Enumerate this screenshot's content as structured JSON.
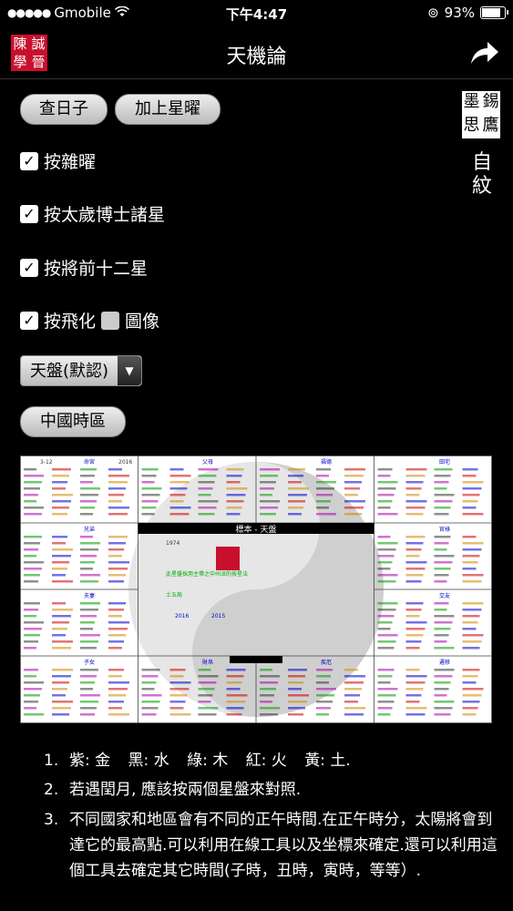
{
  "status_bar": {
    "carrier": "Gmobile",
    "time": "下午4:47",
    "battery": "93%",
    "battery_level": 0.93
  },
  "nav": {
    "title": "天機論",
    "logo_chars": [
      "陳",
      "誠",
      "學",
      "晉"
    ],
    "share_icon": "share-arrow-icon"
  },
  "buttons": {
    "check_day": "查日子",
    "add_stars": "加上星曜"
  },
  "options": {
    "misc_stars": {
      "label": "按雜曜",
      "checked": true
    },
    "taisui": {
      "label": "按太歲博士諸星",
      "checked": true
    },
    "jiangqian": {
      "label": "按將前十二星",
      "checked": true
    },
    "feihua": {
      "label": "按飛化",
      "checked": true
    },
    "image": {
      "label": "圖像",
      "checked": false
    }
  },
  "side": {
    "stamp_chars": [
      "墨",
      "錫",
      "思",
      "鷹"
    ],
    "self_read": "自紋"
  },
  "plate_select": {
    "value": "天盤(默認)"
  },
  "timezone_button": "中國時區",
  "chart": {
    "center_title": "標本 - 天盤",
    "birth_year": "1974",
    "lunar_line": "此星盤採用主帶之中州派的按星法",
    "year_labels": [
      "2016",
      "2015"
    ],
    "mid_label": "土五局",
    "corner_tl": "3-12",
    "corner_tr": "2016",
    "grid_labels": [
      "命宮",
      "父母",
      "福德",
      "田宅",
      "兄弟",
      "官祿",
      "夫妻",
      "交友",
      "子女",
      "財帛",
      "疾厄",
      "遷移"
    ]
  },
  "notes": {
    "items": [
      {
        "num": "1.",
        "legend": [
          "紫: 金",
          "黑: 水",
          "綠: 木",
          "紅: 火",
          "黃: 土."
        ]
      },
      {
        "num": "2.",
        "text": "若遇閏月, 應該按兩個星盤來對照."
      },
      {
        "num": "3.",
        "text": "不同國家和地區會有不同的正午時間.在正午時分，太陽將會到達它的最高點.可以利用在線工具以及坐標來確定.還可以利用這個工具去確定其它時間(子時，丑時，寅時，等等）."
      }
    ]
  }
}
